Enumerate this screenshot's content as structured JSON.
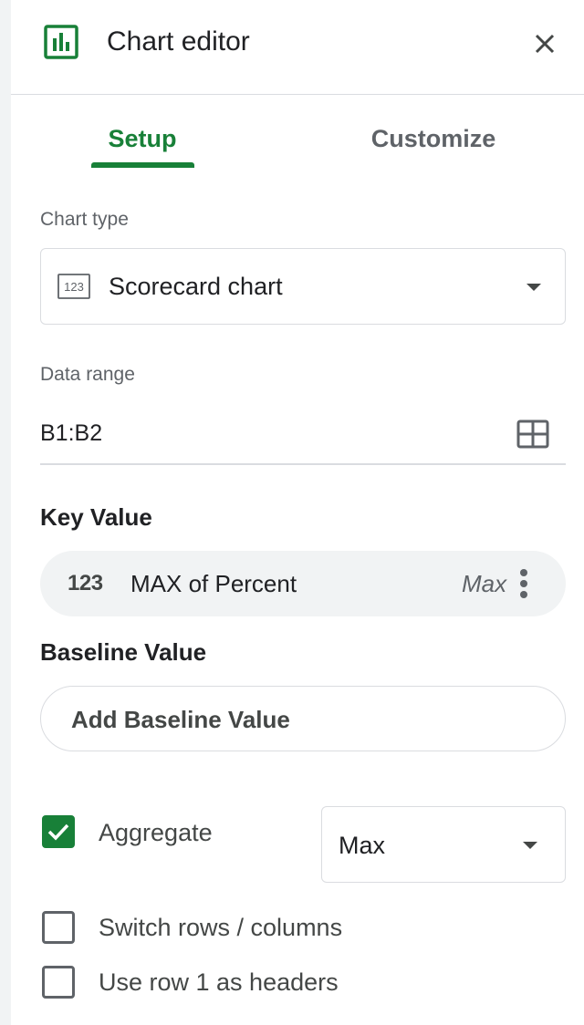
{
  "header": {
    "title": "Chart editor",
    "icon": "chart-editor-icon",
    "close_icon": "close-icon"
  },
  "tabs": [
    {
      "label": "Setup",
      "active": true
    },
    {
      "label": "Customize",
      "active": false
    }
  ],
  "chart_type": {
    "label": "Chart type",
    "value": "Scorecard chart",
    "icon_text": "123"
  },
  "data_range": {
    "label": "Data range",
    "value": "B1:B2",
    "icon": "grid-select-icon"
  },
  "key_value": {
    "title": "Key Value",
    "icon_text": "123",
    "field": "MAX of Percent",
    "aggregation": "Max"
  },
  "baseline_value": {
    "title": "Baseline Value",
    "button_label": "Add Baseline Value"
  },
  "options": {
    "aggregate": {
      "label": "Aggregate",
      "checked": true,
      "select_value": "Max"
    },
    "switch_rows_columns": {
      "label": "Switch rows / columns",
      "checked": false
    },
    "use_row1_headers": {
      "label": "Use row 1 as headers",
      "checked": false
    }
  },
  "colors": {
    "accent": "#188038",
    "text_primary": "#202124",
    "text_secondary": "#5f6368",
    "border": "#dadce0",
    "chip_bg": "#f1f3f4"
  }
}
